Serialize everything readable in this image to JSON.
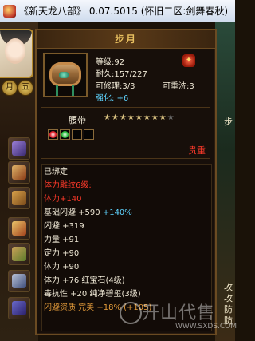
{
  "window": {
    "title": "《新天龙八部》 0.07.5015 (怀旧二区:剑舞春秋)"
  },
  "side_buttons": [
    "月",
    "五"
  ],
  "right_panel": {
    "labels": [
      "步",
      "攻",
      "攻",
      "防",
      "防"
    ]
  },
  "item": {
    "name": "步月",
    "level_label": "等级:92",
    "durability_label": "耐久:157/227",
    "repair_label": "可修理:3/3",
    "rewash_label": "可重洗:3",
    "enhance_label": "强化: +6",
    "category": "腰带",
    "stars": {
      "filled": 8,
      "total": 9
    },
    "gems": [
      {
        "color": "#e0202a",
        "filled": true
      },
      {
        "color": "#30c040",
        "filled": true
      },
      {
        "color": "#000000",
        "filled": false
      },
      {
        "color": "#000000",
        "filled": false
      }
    ],
    "bind_status": "贵重",
    "attributes": [
      {
        "text": "已绑定",
        "color": "white"
      },
      {
        "text": "体力雕纹6级:",
        "color": "red"
      },
      {
        "text": "体力+140",
        "color": "red"
      },
      {
        "text": "基础闪避 +590 +140%",
        "color": "white"
      },
      {
        "text": "闪避 +319",
        "color": "white"
      },
      {
        "text": "力量 +91",
        "color": "white"
      },
      {
        "text": "定力 +90",
        "color": "white"
      },
      {
        "text": "体力 +90",
        "color": "white"
      },
      {
        "text": "体力 +76 红宝石(4级)",
        "color": "white"
      },
      {
        "text": "毒抗性 +20 纯净碧玺(3级)",
        "color": "white"
      },
      {
        "text": "闪避资质  完美 +18% (+105)",
        "color": "orange"
      }
    ]
  },
  "watermark": {
    "main": "开山代售",
    "url": "WWW.SXDS.COM"
  },
  "colors": {
    "panel_bg": "#170f0a",
    "panel_border": "#6b4b22",
    "name_color": "#e8c060",
    "red": "#ff3a2a",
    "cyan": "#5fd4ff",
    "orange": "#e39b3a"
  }
}
